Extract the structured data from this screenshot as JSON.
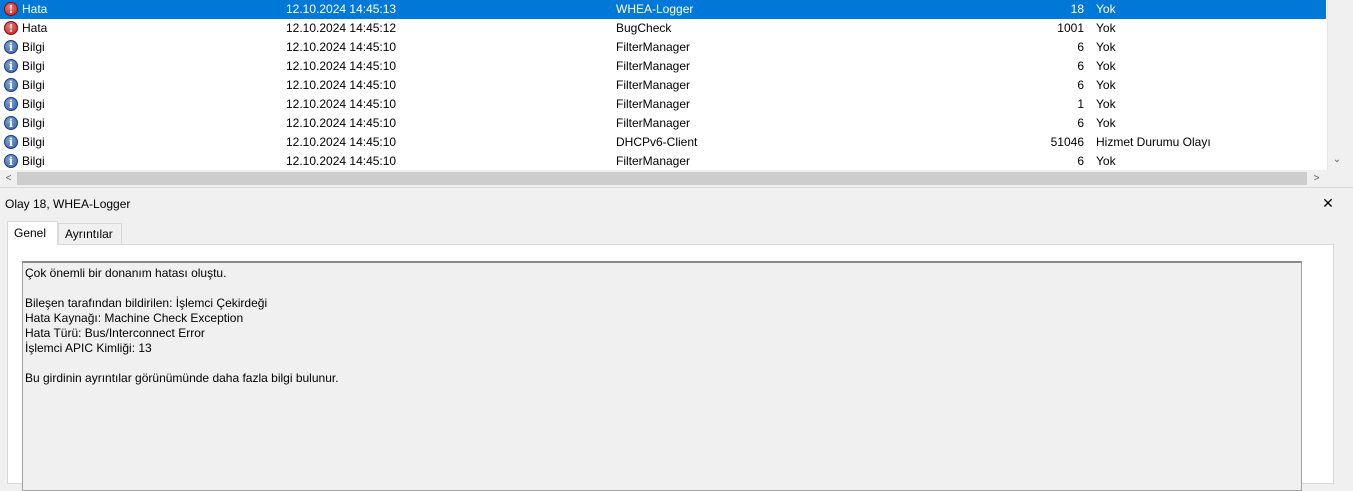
{
  "events": [
    {
      "level": "Hata",
      "level_icon": "error-icon",
      "date": "12.10.2024 14:45:13",
      "source": "WHEA-Logger",
      "event_id": "18",
      "task": "Yok",
      "selected": true
    },
    {
      "level": "Hata",
      "level_icon": "error-icon",
      "date": "12.10.2024 14:45:12",
      "source": "BugCheck",
      "event_id": "1001",
      "task": "Yok"
    },
    {
      "level": "Bilgi",
      "level_icon": "info-icon",
      "date": "12.10.2024 14:45:10",
      "source": "FilterManager",
      "event_id": "6",
      "task": "Yok"
    },
    {
      "level": "Bilgi",
      "level_icon": "info-icon",
      "date": "12.10.2024 14:45:10",
      "source": "FilterManager",
      "event_id": "6",
      "task": "Yok"
    },
    {
      "level": "Bilgi",
      "level_icon": "info-icon",
      "date": "12.10.2024 14:45:10",
      "source": "FilterManager",
      "event_id": "6",
      "task": "Yok"
    },
    {
      "level": "Bilgi",
      "level_icon": "info-icon",
      "date": "12.10.2024 14:45:10",
      "source": "FilterManager",
      "event_id": "1",
      "task": "Yok"
    },
    {
      "level": "Bilgi",
      "level_icon": "info-icon",
      "date": "12.10.2024 14:45:10",
      "source": "FilterManager",
      "event_id": "6",
      "task": "Yok"
    },
    {
      "level": "Bilgi",
      "level_icon": "info-icon",
      "date": "12.10.2024 14:45:10",
      "source": "DHCPv6-Client",
      "event_id": "51046",
      "task": "Hizmet Durumu Olayı"
    },
    {
      "level": "Bilgi",
      "level_icon": "info-icon",
      "date": "12.10.2024 14:45:10",
      "source": "FilterManager",
      "event_id": "6",
      "task": "Yok"
    }
  ],
  "colors": {
    "selection": "#0078d7",
    "error": "#c21a1a",
    "info": "#2f5ea8"
  },
  "detail": {
    "title": "Olay 18, WHEA-Logger",
    "close_icon": "close-icon",
    "tabs": [
      {
        "label": "Genel",
        "active": true
      },
      {
        "label": "Ayrıntılar",
        "active": false
      }
    ],
    "description": "Çok önemli bir donanım hatası oluştu.\n\nBileşen tarafından bildirilen: İşlemci Çekirdeği\nHata Kaynağı: Machine Check Exception\nHata Türü: Bus/Interconnect Error\nİşlemci APIC Kimliği: 13\n\nBu girdinin ayrıntılar görünümünde daha fazla bilgi bulunur."
  }
}
